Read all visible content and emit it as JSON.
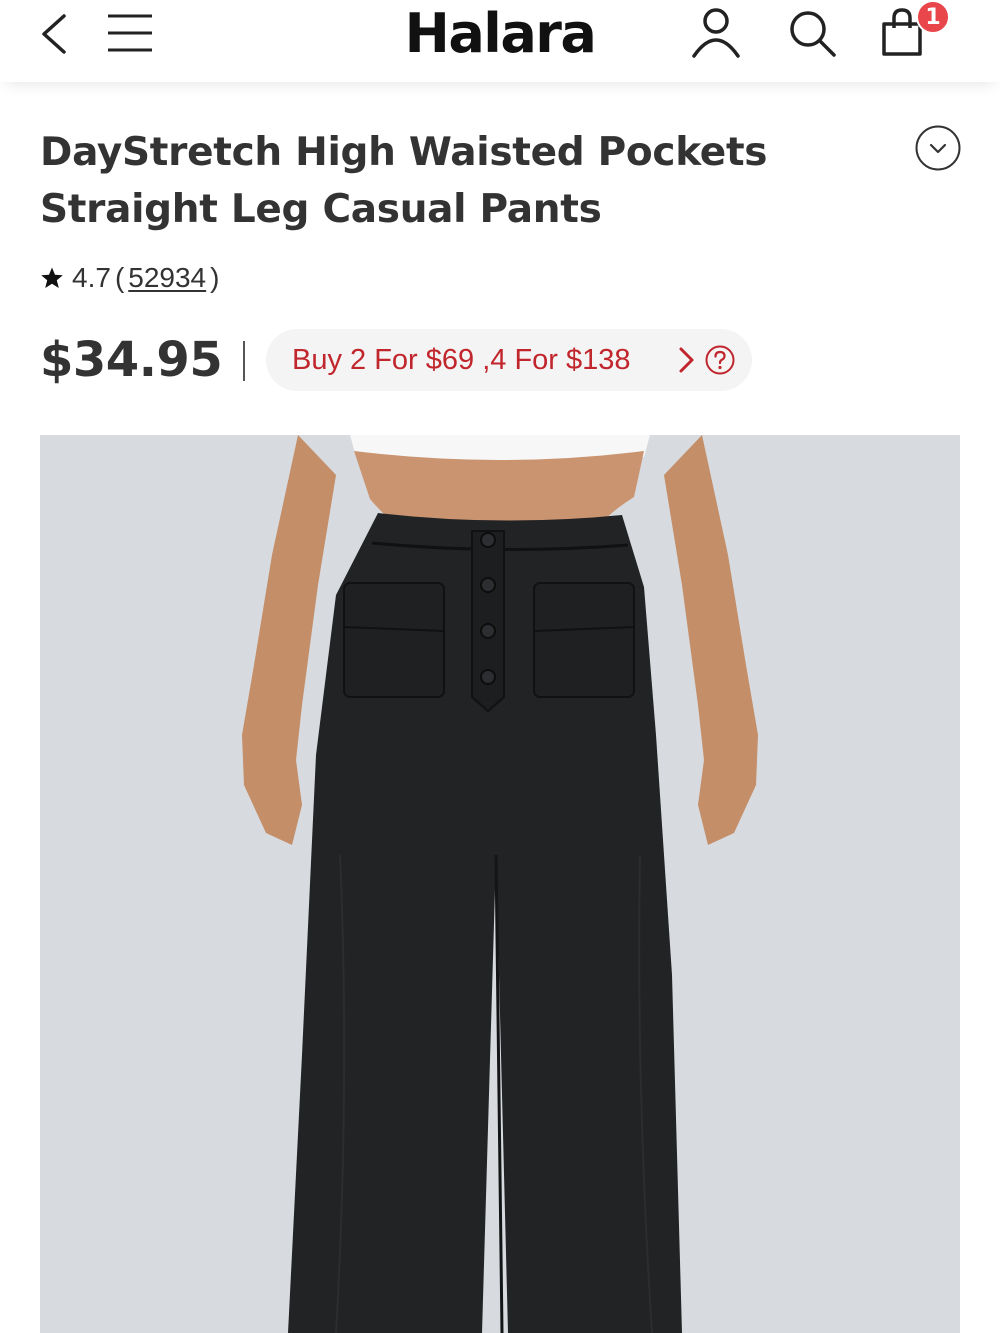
{
  "header": {
    "logo": "Halara",
    "icons": [
      "back-icon",
      "menu-icon",
      "user-icon",
      "search-icon",
      "bag-icon"
    ],
    "cart_count": "1",
    "badge_color": "#e8464a"
  },
  "product": {
    "title": "DayStretch High Waisted Pockets Straight Leg Casual Pants",
    "rating": "4.7",
    "paren_open": "(",
    "review_count": "52934",
    "paren_close": ")",
    "price": "$34.95",
    "promo": "Buy 2 For $69 ,4 For $138",
    "promo_color": "#c0262c"
  }
}
